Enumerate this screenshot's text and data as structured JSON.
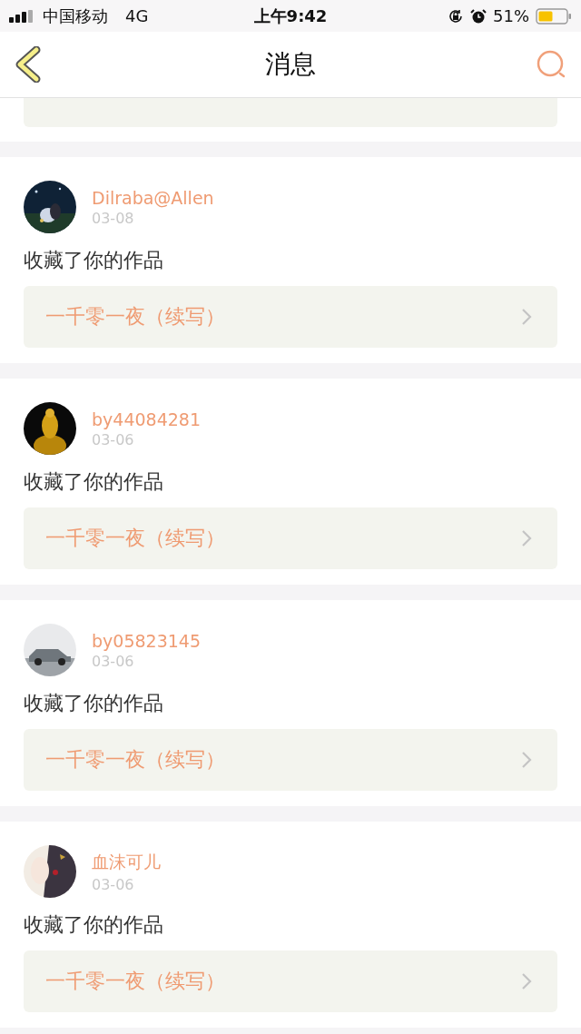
{
  "status_bar": {
    "carrier": "中国移动",
    "network": "4G",
    "time": "上午9:42",
    "battery": "51%"
  },
  "header": {
    "title": "消息"
  },
  "messages": [
    {
      "user": "Dilraba@Allen",
      "date": "03-08",
      "action": "收藏了你的作品",
      "work": "一千零一夜（续写）"
    },
    {
      "user": "by44084281",
      "date": "03-06",
      "action": "收藏了你的作品",
      "work": "一千零一夜（续写）"
    },
    {
      "user": "by05823145",
      "date": "03-06",
      "action": "收藏了你的作品",
      "work": "一千零一夜（续写）"
    },
    {
      "user": "血沫可儿",
      "date": "03-06",
      "action": "收藏了你的作品",
      "work": "一千零一夜（续写）"
    }
  ]
}
